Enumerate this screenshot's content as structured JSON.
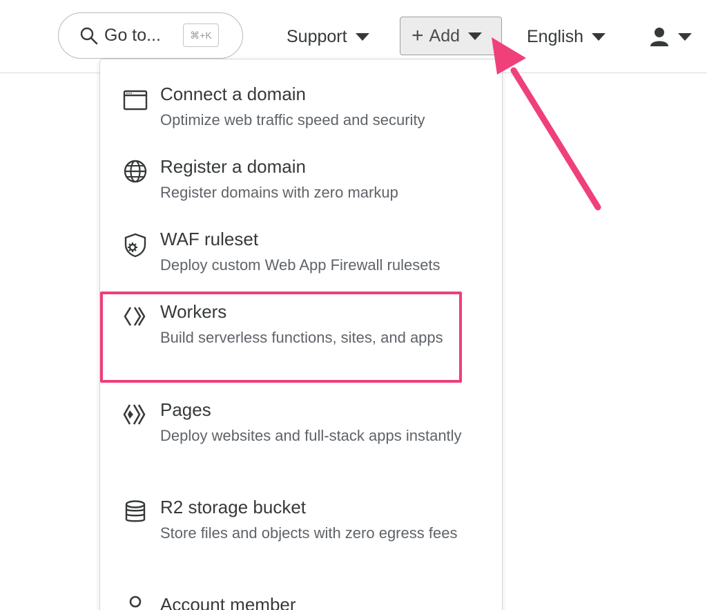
{
  "header": {
    "goto_label": "Go to...",
    "goto_shortcut": "⌘+K",
    "support_label": "Support",
    "add_label": "Add",
    "language_label": "English"
  },
  "menu": {
    "items": [
      {
        "title": "Connect a domain",
        "desc": "Optimize web traffic speed and security",
        "icon": "browser-window-icon"
      },
      {
        "title": "Register a domain",
        "desc": "Register domains with zero markup",
        "icon": "globe-icon"
      },
      {
        "title": "WAF ruleset",
        "desc": "Deploy custom Web App Firewall rulesets",
        "icon": "shield-gear-icon"
      },
      {
        "title": "Workers",
        "desc": "Build serverless functions, sites, and apps",
        "icon": "workers-icon"
      },
      {
        "title": "Pages",
        "desc": "Deploy websites and full-stack apps instantly",
        "icon": "pages-icon"
      },
      {
        "title": "R2 storage bucket",
        "desc": "Store files and objects with zero egress fees",
        "icon": "database-icon"
      },
      {
        "title": "Account member",
        "desc": "",
        "icon": "user-outline-icon"
      }
    ]
  },
  "colors": {
    "highlight": "#ef3e78",
    "arrow": "#f0407a",
    "text": "#36393a",
    "muted": "#5f6368"
  }
}
